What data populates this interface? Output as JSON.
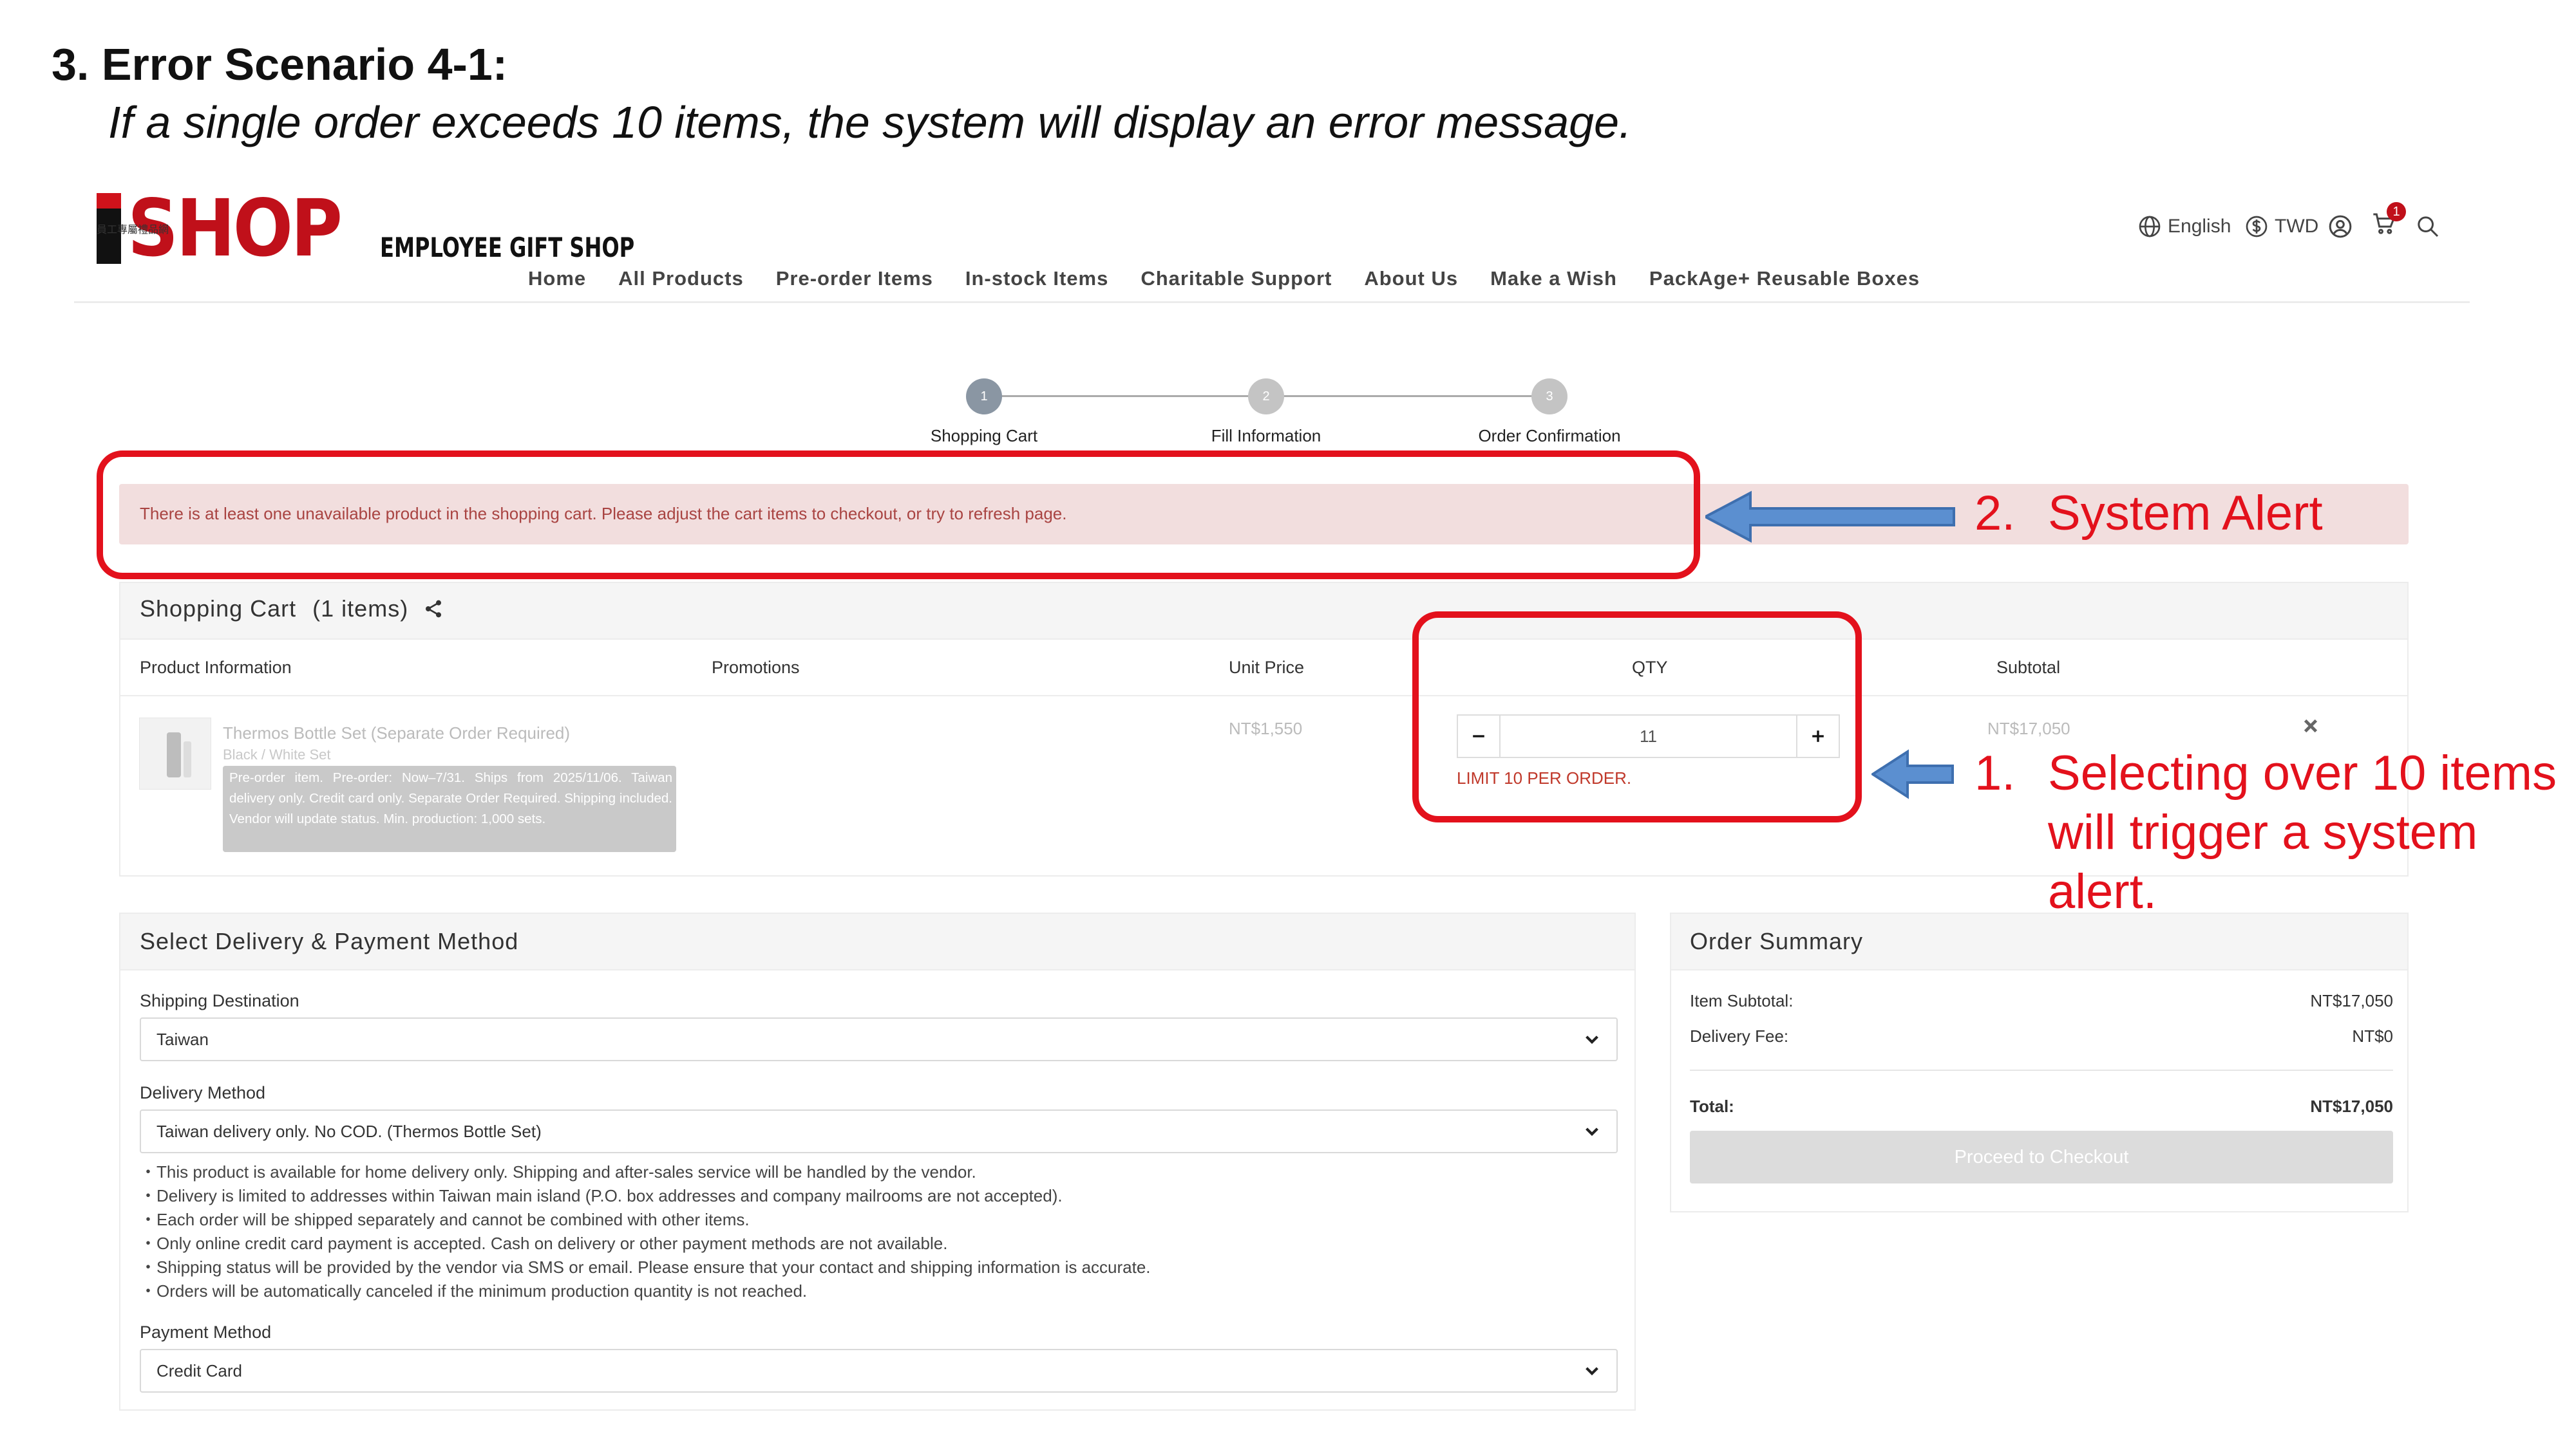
{
  "slide": {
    "heading": "3. Error Scenario 4-1:",
    "subheading": "If a single order exceeds 10 items, the system will display an error message."
  },
  "brand": {
    "logo_text": "SHOP",
    "name_cjk": "員工專屬禮品網",
    "name_en": "EMPLOYEE GIFT SHOP",
    "accent_color": "#c0101a"
  },
  "header": {
    "language": "English",
    "currency": "TWD",
    "cart_count": "1",
    "icons": [
      "globe-icon",
      "dollar-icon",
      "user-icon",
      "cart-icon",
      "search-icon"
    ]
  },
  "nav": {
    "items": [
      "Home",
      "All Products",
      "Pre-order Items",
      "In-stock Items",
      "Charitable Support",
      "About Us",
      "Make a Wish",
      "PackAge+ Reusable Boxes"
    ]
  },
  "stepper": {
    "steps": [
      {
        "num": "1",
        "label": "Shopping Cart",
        "active": true
      },
      {
        "num": "2",
        "label": "Fill Information",
        "active": false
      },
      {
        "num": "3",
        "label": "Order Confirmation",
        "active": false
      }
    ]
  },
  "alert": {
    "text": "There is at least one unavailable product in the shopping cart. Please adjust the cart items to checkout, or try to refresh page."
  },
  "annotations": {
    "system_alert_num": "2.",
    "system_alert": "System Alert",
    "qty_num": "1.",
    "qty_line1": "Selecting over 10 items",
    "qty_line2": "will trigger a system",
    "qty_line3": "alert.",
    "color": "#e3111c",
    "arrow_color": "#5b8fd0"
  },
  "cart": {
    "title": "Shopping Cart",
    "count_label": "(1 items)",
    "columns": {
      "product": "Product Information",
      "promotions": "Promotions",
      "unit_price": "Unit Price",
      "qty": "QTY",
      "subtotal": "Subtotal"
    },
    "item": {
      "name": "Thermos Bottle Set (Separate Order Required)",
      "variant": "Black / White Set",
      "note": "Pre-order item. Pre-order: Now–7/31. Ships from 2025/11/06. Taiwan delivery only. Credit card only. Separate Order Required. Shipping included. Vendor will update status. Min. production: 1,000 sets.",
      "unit_price": "NT$1,550",
      "qty": "11",
      "qty_limit": "LIMIT 10 PER ORDER.",
      "subtotal": "NT$17,050"
    }
  },
  "delivery": {
    "title": "Select Delivery & Payment Method",
    "shipping_label": "Shipping Destination",
    "shipping_value": "Taiwan",
    "method_label": "Delivery Method",
    "method_value": "Taiwan delivery only. No COD. (Thermos Bottle Set)",
    "notes": [
      "・This product is available for home delivery only. Shipping and after-sales service will be handled by the vendor.",
      "・Delivery is limited to addresses within Taiwan main island (P.O. box addresses and company mailrooms are not accepted).",
      "・Each order will be shipped separately and cannot be combined with other items.",
      "・Only online credit card payment is accepted. Cash on delivery or other payment methods are not available.",
      "・Shipping status will be provided by the vendor via SMS or email. Please ensure that your contact and shipping information is accurate.",
      "・Orders will be automatically canceled if the minimum production quantity is not reached."
    ],
    "payment_label": "Payment Method",
    "payment_value": "Credit Card"
  },
  "summary": {
    "title": "Order Summary",
    "item_subtotal_label": "Item Subtotal:",
    "item_subtotal": "NT$17,050",
    "delivery_fee_label": "Delivery Fee:",
    "delivery_fee": "NT$0",
    "total_label": "Total:",
    "total": "NT$17,050",
    "checkout_label": "Proceed to Checkout"
  }
}
